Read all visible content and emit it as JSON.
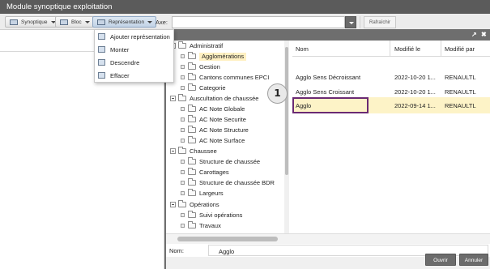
{
  "app": {
    "title": "Module synoptique exploitation"
  },
  "toolbar": {
    "synoptique_label": "Synoptique",
    "bloc_label": "Bloc",
    "representation_label": "Représentation",
    "axe_label": "Axe:",
    "axe_value": "",
    "refresh_label": "Rafraîchir"
  },
  "menu": {
    "items": [
      {
        "label": "Ajouter représentation"
      },
      {
        "label": "Monter"
      },
      {
        "label": "Descendre"
      },
      {
        "label": "Effacer"
      }
    ]
  },
  "dialog": {
    "controls": {
      "restore": "↗",
      "close": "✖"
    },
    "tree": [
      {
        "label": "Administratif"
      },
      {
        "label": "Agglomérations"
      },
      {
        "label": "Gestion"
      },
      {
        "label": "Cantons communes EPCI"
      },
      {
        "label": "Categorie"
      },
      {
        "label": "Auscultation de chaussée"
      },
      {
        "label": "AC Note Globale"
      },
      {
        "label": "AC Note Securite"
      },
      {
        "label": "AC Note Structure"
      },
      {
        "label": "AC Note Surface"
      },
      {
        "label": "Chaussee"
      },
      {
        "label": "Structure de chaussée"
      },
      {
        "label": "Carottages"
      },
      {
        "label": "Structure de chaussée BDR"
      },
      {
        "label": "Largeurs"
      },
      {
        "label": "Opérations"
      },
      {
        "label": "Suivi opérations"
      },
      {
        "label": "Travaux"
      }
    ],
    "table": {
      "columns": [
        "Nom",
        "Modifié le",
        "Modifié par"
      ],
      "rows": [
        {
          "nom": "Agglo Sens Décroissant",
          "date": "2022-10-20 1...",
          "par": "RENAULTL"
        },
        {
          "nom": "Agglo Sens Croissant",
          "date": "2022-10-20 1...",
          "par": "RENAULTL"
        },
        {
          "nom": "Agglo",
          "date": "2022-09-14 1...",
          "par": "RENAULTL"
        }
      ]
    },
    "name_label": "Nom:",
    "name_value": "Agglo",
    "ok_label": "Ouvrir",
    "cancel_label": "Annuler"
  },
  "marker": {
    "number": "1"
  }
}
